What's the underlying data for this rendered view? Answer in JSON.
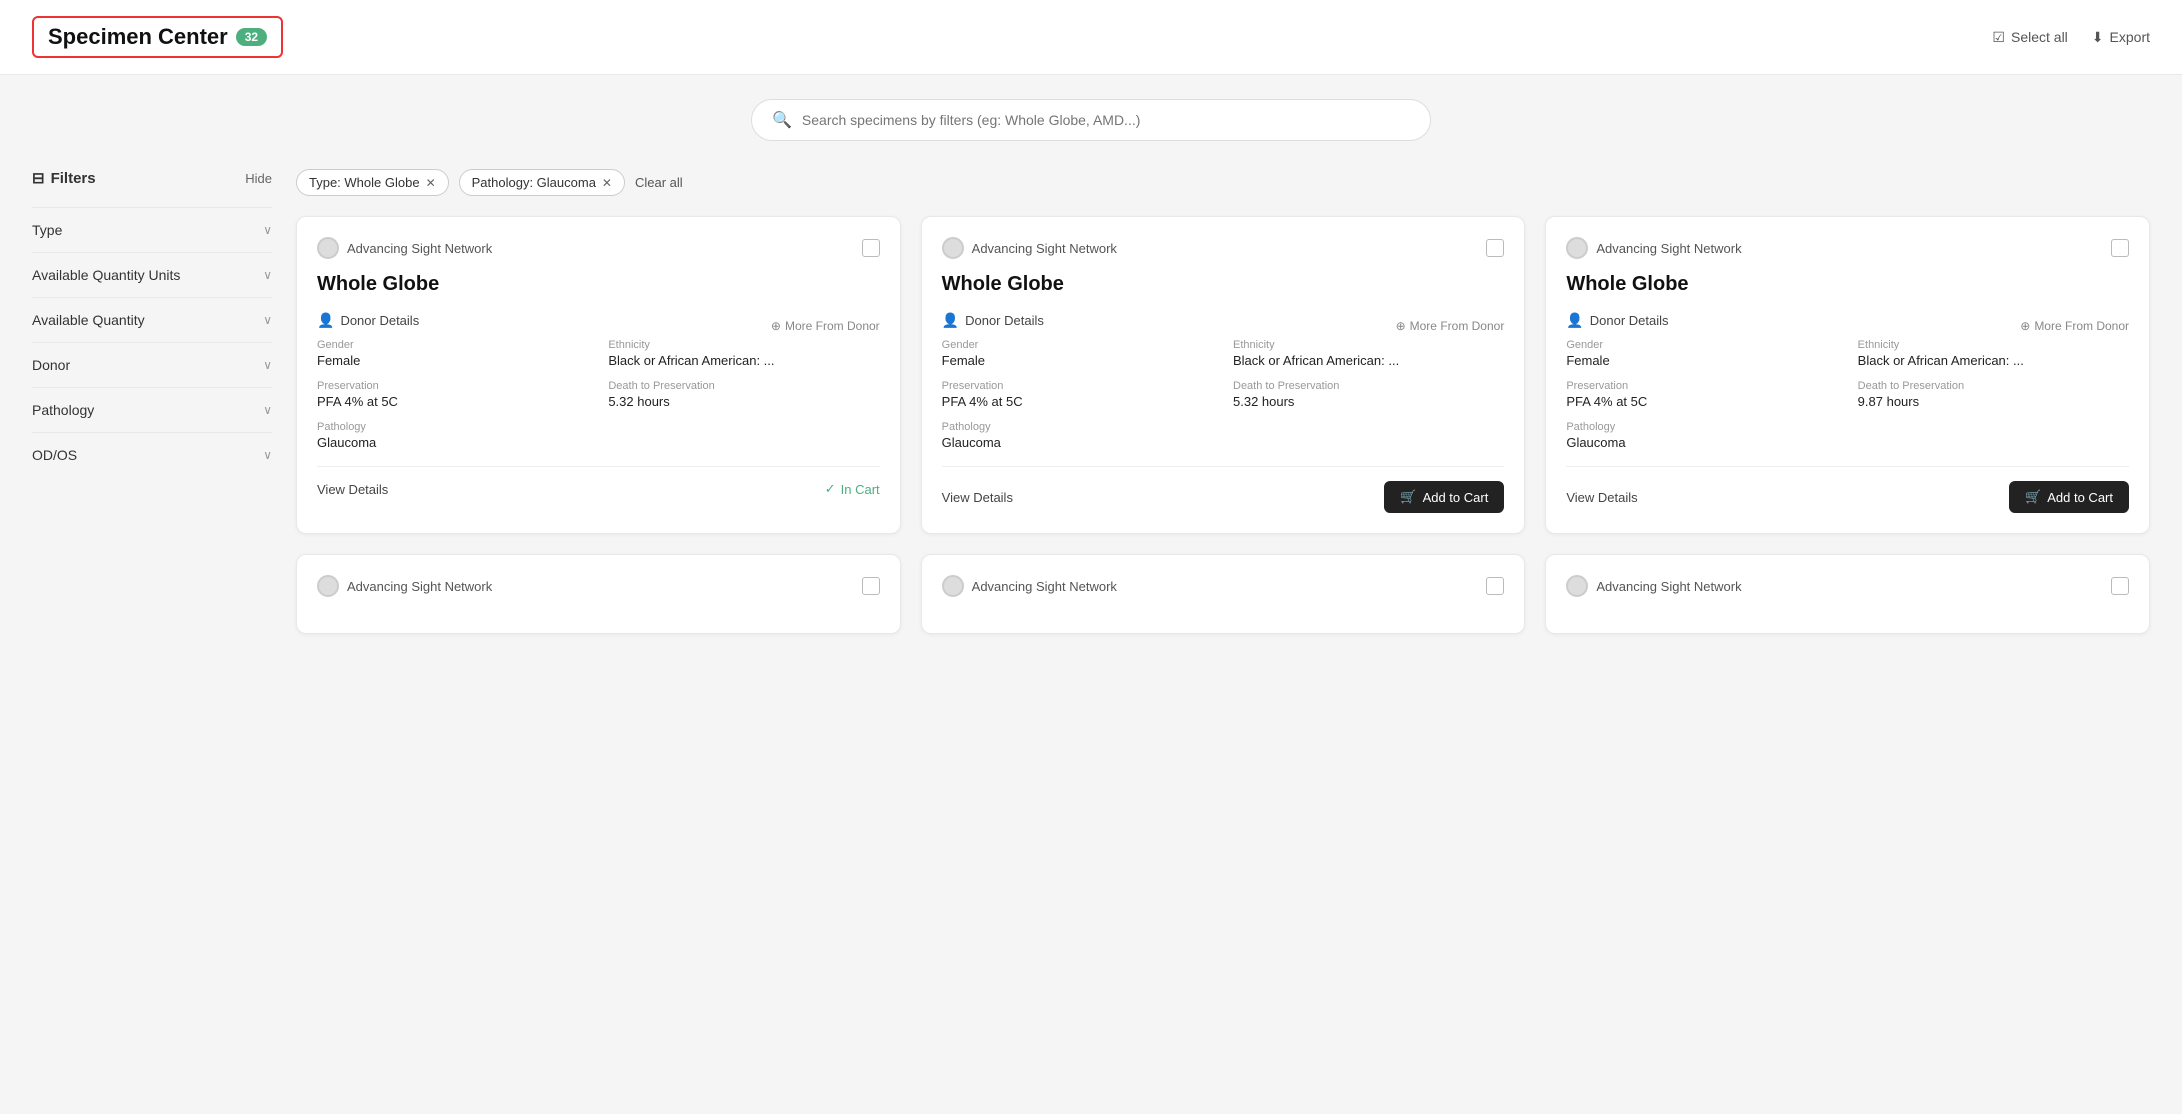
{
  "header": {
    "title": "Specimen Center",
    "count": "32",
    "select_all_label": "Select all",
    "export_label": "Export"
  },
  "search": {
    "placeholder": "Search specimens by filters (eg: Whole Globe, AMD...)"
  },
  "filters": {
    "title": "Filters",
    "hide_label": "Hide",
    "active_tags": [
      {
        "label": "Type: Whole Globe"
      },
      {
        "label": "Pathology: Glaucoma"
      }
    ],
    "clear_all_label": "Clear all",
    "sections": [
      {
        "label": "Type"
      },
      {
        "label": "Available Quantity Units"
      },
      {
        "label": "Available Quantity"
      },
      {
        "label": "Donor"
      },
      {
        "label": "Pathology"
      },
      {
        "label": "OD/OS"
      }
    ]
  },
  "cards": [
    {
      "network": "Advancing Sight Network",
      "type": "Whole Globe",
      "donor_details_label": "Donor Details",
      "more_from_donor_label": "More From Donor",
      "gender_label": "Gender",
      "gender_value": "Female",
      "ethnicity_label": "Ethnicity",
      "ethnicity_value": "Black or African American: ...",
      "preservation_label": "Preservation",
      "preservation_value": "PFA 4% at 5C",
      "death_to_preservation_label": "Death to Preservation",
      "death_to_preservation_value": "5.32 hours",
      "pathology_label": "Pathology",
      "pathology_value": "Glaucoma",
      "view_details_label": "View Details",
      "action_label": "In Cart",
      "action_type": "in_cart",
      "checked": false
    },
    {
      "network": "Advancing Sight Network",
      "type": "Whole Globe",
      "donor_details_label": "Donor Details",
      "more_from_donor_label": "More From Donor",
      "gender_label": "Gender",
      "gender_value": "Female",
      "ethnicity_label": "Ethnicity",
      "ethnicity_value": "Black or African American: ...",
      "preservation_label": "Preservation",
      "preservation_value": "PFA 4% at 5C",
      "death_to_preservation_label": "Death to Preservation",
      "death_to_preservation_value": "5.32 hours",
      "pathology_label": "Pathology",
      "pathology_value": "Glaucoma",
      "view_details_label": "View Details",
      "action_label": "Add to Cart",
      "action_type": "add_to_cart",
      "checked": false
    },
    {
      "network": "Advancing Sight Network",
      "type": "Whole Globe",
      "donor_details_label": "Donor Details",
      "more_from_donor_label": "More From Donor",
      "gender_label": "Gender",
      "gender_value": "Female",
      "ethnicity_label": "Ethnicity",
      "ethnicity_value": "Black or African American: ...",
      "preservation_label": "Preservation",
      "preservation_value": "PFA 4% at 5C",
      "death_to_preservation_label": "Death to Preservation",
      "death_to_preservation_value": "9.87 hours",
      "pathology_label": "Pathology",
      "pathology_value": "Glaucoma",
      "view_details_label": "View Details",
      "action_label": "Add to Cart",
      "action_type": "add_to_cart",
      "checked": false
    }
  ],
  "second_row_cards": [
    {
      "network": "Advancing Sight Network"
    },
    {
      "network": "Advancing Sight Network"
    },
    {
      "network": "Advancing Sight Network"
    }
  ]
}
